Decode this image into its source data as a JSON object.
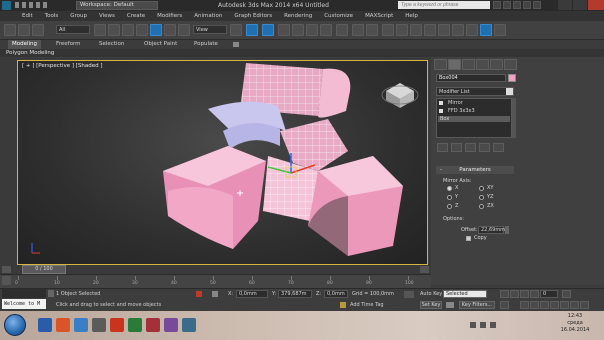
{
  "titlebar": {
    "workspace": "Workspace: Default",
    "title": "Autodesk 3ds Max  2014 x64       Untitled",
    "search_placeholder": "Type a keyword or phrase"
  },
  "menu": [
    "Edit",
    "Tools",
    "Group",
    "Views",
    "Create",
    "Modifiers",
    "Animation",
    "Graph Editors",
    "Rendering",
    "Customize",
    "MAXScript",
    "Help"
  ],
  "toolbar": {
    "selection_filter": "All",
    "reference_coord": "View"
  },
  "ribbon": {
    "tabs": [
      "Modeling",
      "Freeform",
      "Selection",
      "Object Paint",
      "Populate"
    ],
    "active_tab": "Modeling",
    "subpanel": "Polygon Modeling"
  },
  "viewport": {
    "label": "[ + ] [Perspective ] [Shaded ]"
  },
  "command_panel": {
    "object_name": "Box004",
    "object_color": "#f0a3c3",
    "modifier_list": "Modifier List",
    "stack": [
      "Mirror",
      "FFD 3x3x3",
      "Box"
    ],
    "rollout_title": "Parameters",
    "mirror_axis_label": "Mirror Axis:",
    "axes": [
      "X",
      "Y",
      "Z",
      "XY",
      "YZ",
      "ZX"
    ],
    "options_label": "Options:",
    "offset_label": "Offset:",
    "offset_value": "22,69mm",
    "copy_label": "Copy"
  },
  "timeline": {
    "slider": "0 / 100",
    "ticks": [
      "0",
      "10",
      "20",
      "30",
      "40",
      "50",
      "60",
      "70",
      "80",
      "90",
      "100"
    ]
  },
  "status": {
    "maxscript": "Welcome to M",
    "selected": "1 Object Selected",
    "prompt": "Click and drag to select and move objects",
    "x_label": "X:",
    "x_value": "0,0mm",
    "y_label": "Y:",
    "y_value": "379,687m",
    "z_label": "Z:",
    "z_value": "0,0mm",
    "grid": "Grid = 100,0mm",
    "add_time_tag": "Add Time Tag",
    "auto_key": "Auto Key",
    "anim_selection": "Selected",
    "set_key": "Set Key",
    "key_filters": "Key Filters...",
    "frame": "0"
  },
  "taskbar": {
    "time": "12:43",
    "day": "среда",
    "date": "16.04.2014"
  },
  "icons": [
    "app-logo-icon",
    "search-icon",
    "help-icon",
    "minimize-icon",
    "maximize-icon",
    "close-icon",
    "windows-start-icon"
  ]
}
